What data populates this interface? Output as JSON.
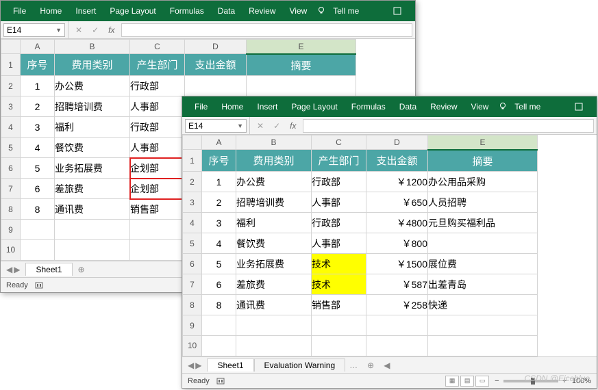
{
  "menu": [
    "File",
    "Home",
    "Insert",
    "Page Layout",
    "Formulas",
    "Data",
    "Review",
    "View"
  ],
  "tell_me": "Tell me",
  "name_box": "E14",
  "fx_label": "fx",
  "columns": [
    "A",
    "B",
    "C",
    "D",
    "E"
  ],
  "headers": {
    "A": "序号",
    "B": "费用类别",
    "C": "产生部门",
    "D": "支出金额",
    "E": "摘要"
  },
  "sheet_tab": "Sheet1",
  "eval_tab": "Evaluation Warning",
  "status_ready": "Ready",
  "zoom": "100%",
  "watermark": "CSDN @Eiceblue",
  "win1_rows": [
    {
      "n": "1",
      "b": "办公费",
      "c": "行政部",
      "d": "",
      "e": ""
    },
    {
      "n": "2",
      "b": "招聘培训费",
      "c": "人事部",
      "d": "",
      "e": ""
    },
    {
      "n": "3",
      "b": "福利",
      "c": "行政部",
      "d": "",
      "e": ""
    },
    {
      "n": "4",
      "b": "餐饮费",
      "c": "人事部",
      "d": "",
      "e": ""
    },
    {
      "n": "5",
      "b": "业务拓展费",
      "c": "企划部",
      "d": "",
      "e": "",
      "red": true
    },
    {
      "n": "6",
      "b": "差旅费",
      "c": "企划部",
      "d": "",
      "e": "",
      "red": true
    },
    {
      "n": "8",
      "b": "通讯费",
      "c": "销售部",
      "d": "",
      "e": ""
    }
  ],
  "win2_rows": [
    {
      "n": "1",
      "b": "办公费",
      "c": "行政部",
      "d": "￥1200",
      "e": "办公用品采购"
    },
    {
      "n": "2",
      "b": "招聘培训费",
      "c": "人事部",
      "d": "￥650",
      "e": "人员招聘"
    },
    {
      "n": "3",
      "b": "福利",
      "c": "行政部",
      "d": "￥4800",
      "e": "元旦购买福利品"
    },
    {
      "n": "4",
      "b": "餐饮费",
      "c": "人事部",
      "d": "￥800",
      "e": ""
    },
    {
      "n": "5",
      "b": "业务拓展费",
      "c": "技术",
      "d": "￥1500",
      "e": "展位费",
      "yellow": true
    },
    {
      "n": "6",
      "b": "差旅费",
      "c": "技术",
      "d": "￥587",
      "e": "出差青岛",
      "yellow": true
    },
    {
      "n": "8",
      "b": "通讯费",
      "c": "销售部",
      "d": "￥258",
      "e": "快递"
    }
  ],
  "row_labels": [
    "1",
    "2",
    "3",
    "4",
    "5",
    "6",
    "7",
    "8",
    "9",
    "10"
  ]
}
